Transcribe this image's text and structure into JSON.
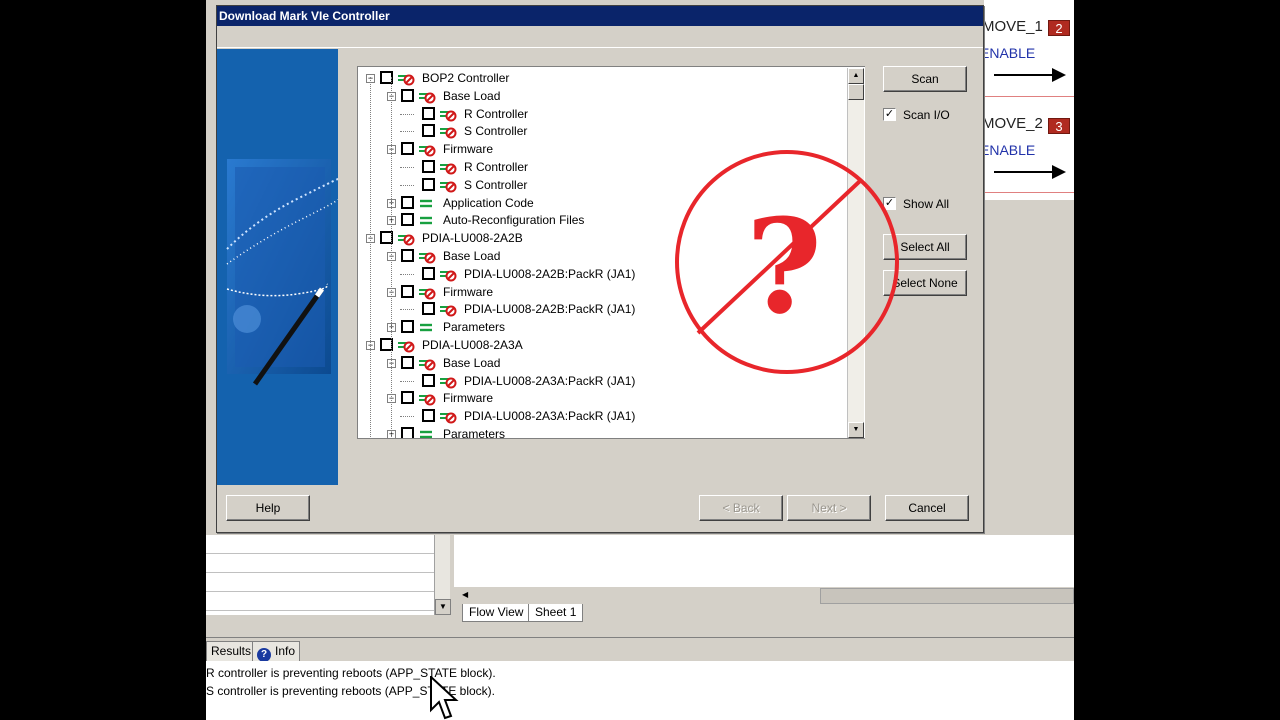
{
  "dialog": {
    "title": "Download Mark VIe Controller",
    "tree": [
      {
        "label": "BOP2 Controller",
        "level": 0,
        "expander": "−",
        "icon": "blocked"
      },
      {
        "label": "Base Load",
        "level": 1,
        "expander": "−",
        "icon": "blocked"
      },
      {
        "label": "R Controller",
        "level": 2,
        "expander": "",
        "icon": "blocked"
      },
      {
        "label": "S Controller",
        "level": 2,
        "expander": "",
        "icon": "blocked"
      },
      {
        "label": "Firmware",
        "level": 1,
        "expander": "−",
        "icon": "blocked"
      },
      {
        "label": "R Controller",
        "level": 2,
        "expander": "",
        "icon": "blocked"
      },
      {
        "label": "S Controller",
        "level": 2,
        "expander": "",
        "icon": "blocked"
      },
      {
        "label": "Application Code",
        "level": 1,
        "expander": "+",
        "icon": "equal"
      },
      {
        "label": "Auto-Reconfiguration Files",
        "level": 1,
        "expander": "+",
        "icon": "equal"
      },
      {
        "label": "PDIA-LU008-2A2B",
        "level": 0,
        "expander": "−",
        "icon": "blocked"
      },
      {
        "label": "Base Load",
        "level": 1,
        "expander": "−",
        "icon": "blocked"
      },
      {
        "label": "PDIA-LU008-2A2B:PackR (JA1)",
        "level": 2,
        "expander": "",
        "icon": "blocked"
      },
      {
        "label": "Firmware",
        "level": 1,
        "expander": "−",
        "icon": "blocked"
      },
      {
        "label": "PDIA-LU008-2A2B:PackR (JA1)",
        "level": 2,
        "expander": "",
        "icon": "blocked"
      },
      {
        "label": "Parameters",
        "level": 1,
        "expander": "+",
        "icon": "equal"
      },
      {
        "label": "PDIA-LU008-2A3A",
        "level": 0,
        "expander": "−",
        "icon": "blocked"
      },
      {
        "label": "Base Load",
        "level": 1,
        "expander": "−",
        "icon": "blocked"
      },
      {
        "label": "PDIA-LU008-2A3A:PackR (JA1)",
        "level": 2,
        "expander": "",
        "icon": "blocked"
      },
      {
        "label": "Firmware",
        "level": 1,
        "expander": "−",
        "icon": "blocked"
      },
      {
        "label": "PDIA-LU008-2A3A:PackR (JA1)",
        "level": 2,
        "expander": "",
        "icon": "blocked"
      },
      {
        "label": "Parameters",
        "level": 1,
        "expander": "+",
        "icon": "equal"
      }
    ],
    "scan_label": "Scan",
    "scan_io_label": "Scan I/O",
    "scan_io_checked": "✓",
    "show_all_label": "Show All",
    "show_all_checked": "✓",
    "select_all_label": "Select All",
    "select_none_label": "Select None",
    "help_label": "Help",
    "back_label": "< Back",
    "next_label": "Next >",
    "cancel_label": "Cancel"
  },
  "background": {
    "move1_label": "MOVE_1",
    "move1_num": "2",
    "enable1_label": "ENABLE",
    "move2_label": "MOVE_2",
    "move2_num": "3",
    "enable2_label": "ENABLE",
    "sheet_tabs": [
      "Flow View",
      "Sheet 1"
    ],
    "bottom_tabs": [
      "Results",
      "Info"
    ],
    "log": [
      "R controller is preventing reboots (APP_STATE block).",
      "S controller is preventing reboots (APP_STATE block)."
    ]
  },
  "overlay": {
    "symbol": "?",
    "color": "#e8262b"
  },
  "colors": {
    "titlebar": "#0a246a",
    "wizard_panel": "#1462ae",
    "dialog_face": "#d4d0c8"
  }
}
